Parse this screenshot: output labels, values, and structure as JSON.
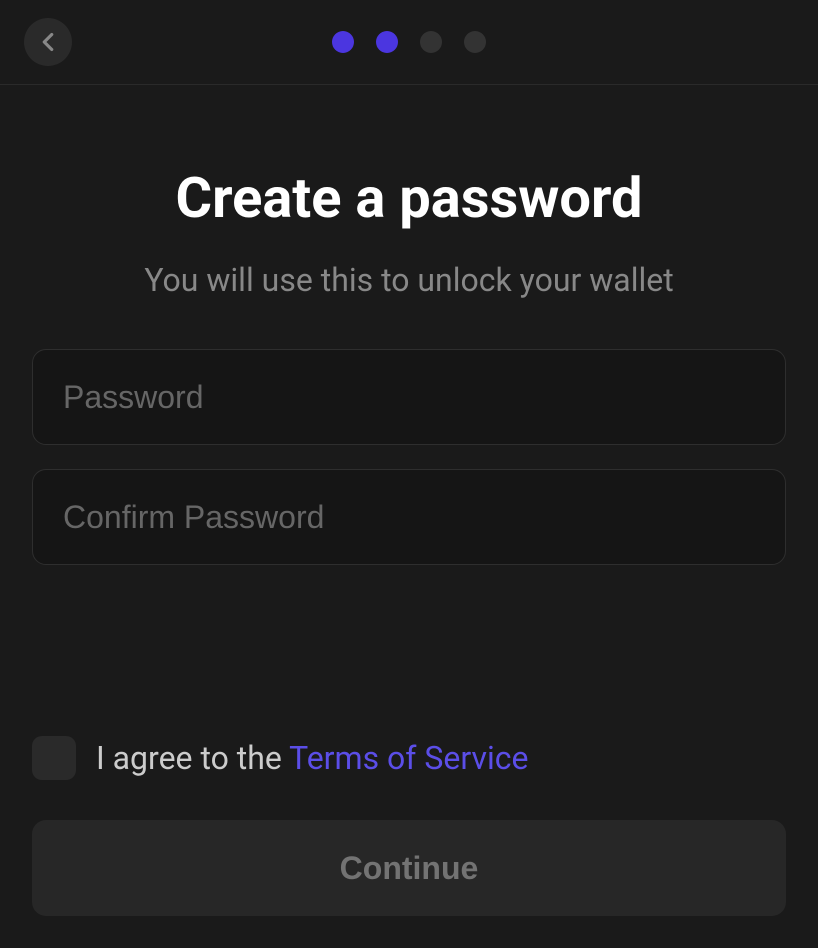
{
  "header": {
    "progress": {
      "total": 4,
      "current": 2
    }
  },
  "colors": {
    "accent": "#4b36e0",
    "link": "#5b4ee8"
  },
  "main": {
    "title": "Create a password",
    "subtitle": "You will use this to unlock your wallet",
    "password_placeholder": "Password",
    "password_value": "",
    "confirm_password_placeholder": "Confirm Password",
    "confirm_password_value": ""
  },
  "terms": {
    "checked": false,
    "text_prefix": "I agree to the ",
    "link_text": "Terms of Service"
  },
  "footer": {
    "continue_label": "Continue"
  }
}
